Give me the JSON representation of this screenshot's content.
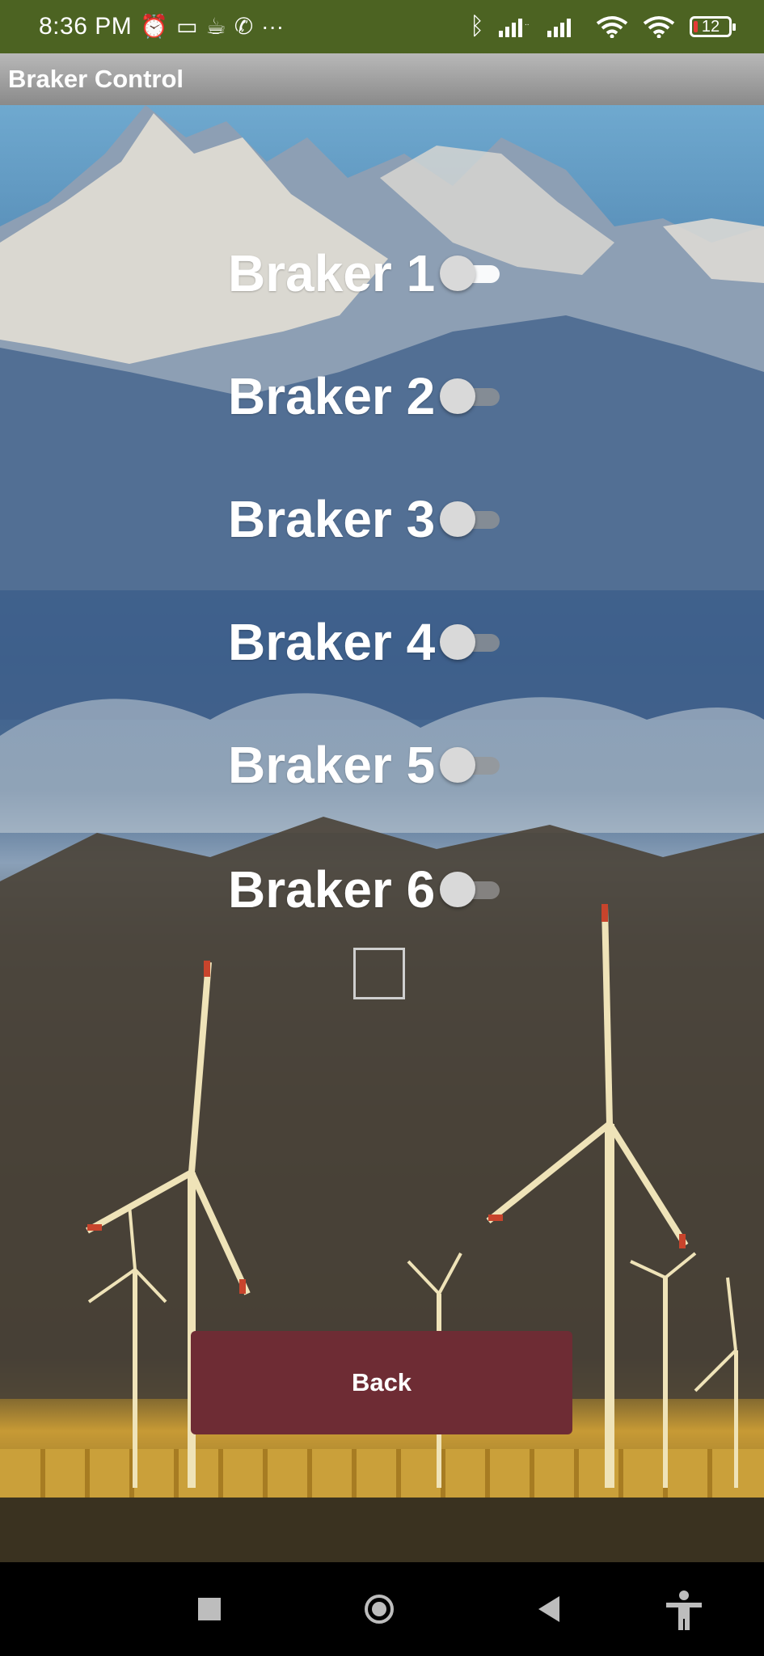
{
  "status_bar": {
    "time": "8:36 PM",
    "more": "···",
    "battery": "12",
    "icons": [
      "alarm-icon",
      "message-icon",
      "app-icon",
      "signal-app-icon",
      "bluetooth-icon",
      "cell-signal-icon",
      "cell-signal-icon",
      "wifi-icon",
      "wifi-icon",
      "battery-icon"
    ]
  },
  "app_bar": {
    "title": "Braker Control"
  },
  "switches": [
    {
      "label": "Braker 1",
      "on": true
    },
    {
      "label": "Braker 2",
      "on": false
    },
    {
      "label": "Braker 3",
      "on": false
    },
    {
      "label": "Braker 4",
      "on": false
    },
    {
      "label": "Braker 5",
      "on": false
    },
    {
      "label": "Braker 6",
      "on": false
    }
  ],
  "checkbox": {
    "checked": false
  },
  "back_button": {
    "label": "Back",
    "color": "#6e2c34"
  },
  "nav_bar": {
    "icons": [
      "recents-square-icon",
      "home-circle-icon",
      "back-triangle-icon",
      "accessibility-icon"
    ]
  }
}
